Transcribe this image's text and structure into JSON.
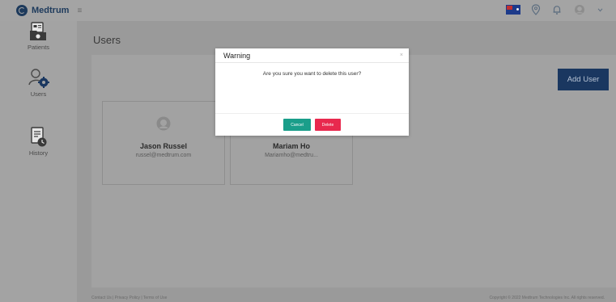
{
  "app": {
    "name": "Medtrum"
  },
  "header": {
    "menu_glyph": "≡"
  },
  "sidebar": {
    "items": [
      {
        "label": "Patients",
        "icon": "patients-icon"
      },
      {
        "label": "Users",
        "icon": "users-gear-icon"
      },
      {
        "label": "History",
        "icon": "history-icon"
      }
    ]
  },
  "page": {
    "title": "Users",
    "add_user_label": "Add User"
  },
  "users": [
    {
      "name": "Jason Russel",
      "email": "russel@medtrum.com"
    },
    {
      "name": "Mariam Ho",
      "email": "Mariamho@medtru..."
    }
  ],
  "footer": {
    "left": "Contact Us | Privacy Policy | Terms of Use",
    "right": "Copyright © 2022 Medtrum Technologies Inc. All rights reserved."
  },
  "modal": {
    "title": "Warning",
    "close_glyph": "×",
    "message": "Are you sure you want to delete this user?",
    "cancel_label": "Cancel",
    "delete_label": "Delete"
  },
  "colors": {
    "brand_navy": "#1a3760",
    "cancel_green": "#1a9e8a",
    "delete_red": "#e8294e"
  }
}
